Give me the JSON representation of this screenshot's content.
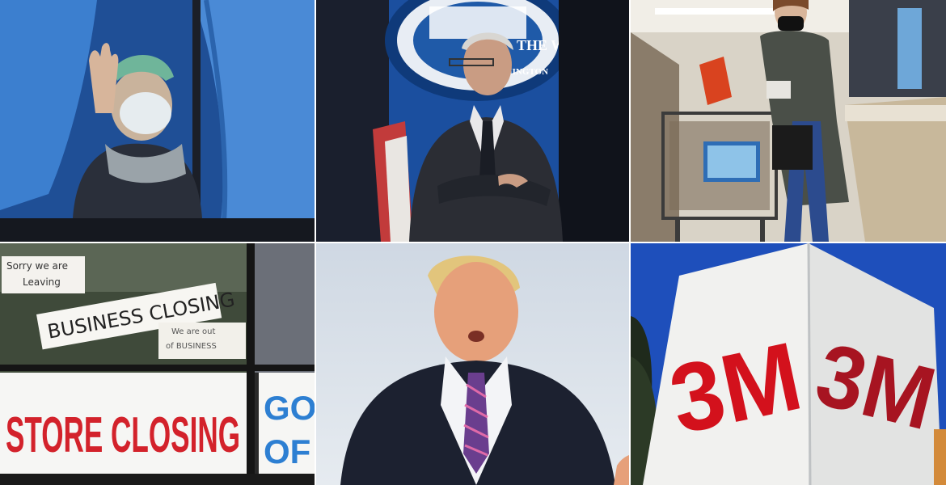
{
  "tiles": [
    {
      "subject": "masked person parting a blue curtain at a window"
    },
    {
      "subject": "man with arms crossed at a press briefing",
      "seal_text": [
        "THE WHITE HOU",
        "ASHINGTON"
      ]
    },
    {
      "subject": "masked shopper with a cart at a grocery checkout"
    },
    {
      "subject": "store windows with closing signs",
      "signs": {
        "handwritten_small": [
          "Sorry we are",
          "Leaving"
        ],
        "handwritten_large": "BUSINESS CLOSING",
        "handwritten_note": [
          "We are out",
          "of BUSINESS"
        ],
        "banner": "STORE CLOSING",
        "side_banner": [
          "GO",
          "OF"
        ]
      }
    },
    {
      "subject": "man in a dark suit and striped tie speaking outdoors"
    },
    {
      "subject": "white corporate sign with red logo",
      "logo_left": "3M",
      "logo_right": "3M"
    }
  ]
}
